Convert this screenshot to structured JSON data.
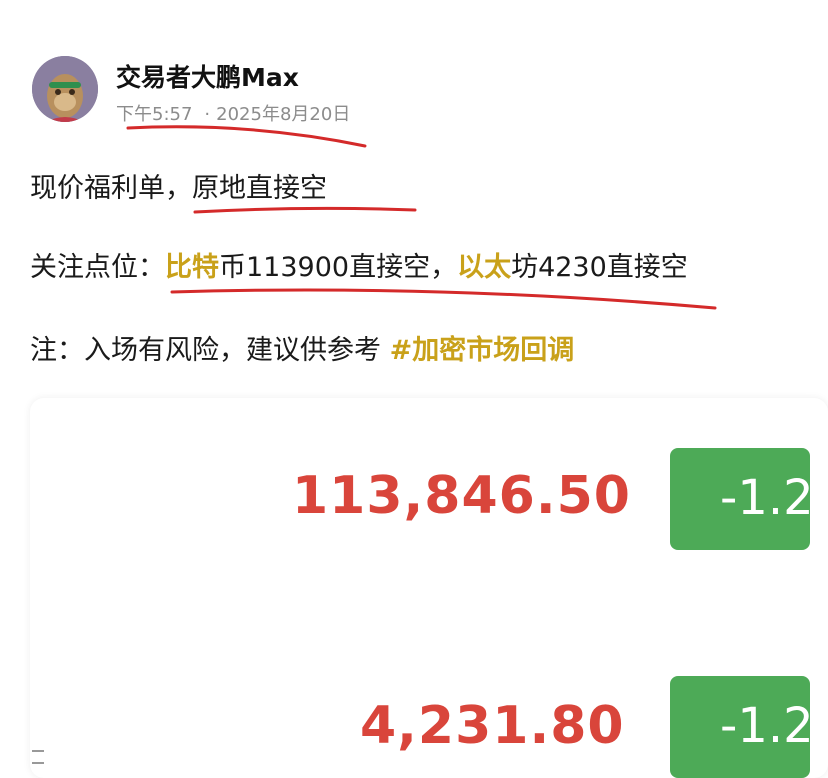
{
  "post": {
    "author": "交易者大鹏Max",
    "time": "下午5:57",
    "separator": "·",
    "date": "2025年8月20日",
    "line1": {
      "prefix": "现价福利单，",
      "main": "原地直接空"
    },
    "line2": {
      "label": "关注点位：",
      "hl1": "比特",
      "text1": "币113900直接空，",
      "hl2": "以太",
      "text2": "坊4230直接空"
    },
    "line3": {
      "text": "注：入场有风险，建议供参考 ",
      "tag": "#加密市场回调"
    }
  },
  "tickers": [
    {
      "price": "113,846.50",
      "change": "-1.2"
    },
    {
      "price": "4,231.80",
      "change": "-1.2"
    }
  ],
  "colors": {
    "accent": "#c9a11a",
    "price_red": "#d9453b",
    "change_green": "#4daa57",
    "annotation_red": "#d42a2a"
  }
}
